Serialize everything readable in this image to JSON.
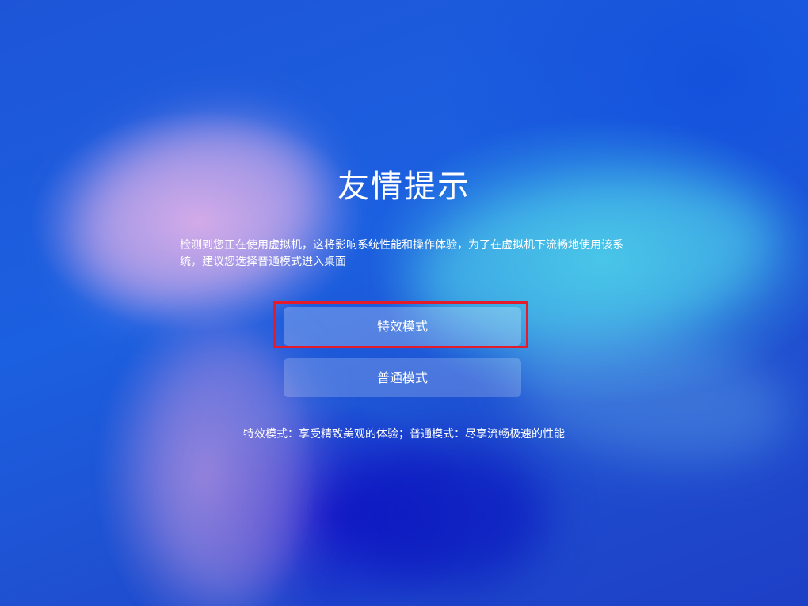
{
  "dialog": {
    "title": "友情提示",
    "message": "检测到您正在使用虚拟机，这将影响系统性能和操作体验，为了在虚拟机下流畅地使用该系统，建议您选择普通模式进入桌面",
    "buttons": {
      "effects_mode": "特效模式",
      "normal_mode": "普通模式"
    },
    "footnote": "特效模式：享受精致美观的体验；普通模式：尽享流畅极速的性能"
  },
  "colors": {
    "background": "#1a4fd6",
    "highlight_border": "#e31b2a"
  }
}
